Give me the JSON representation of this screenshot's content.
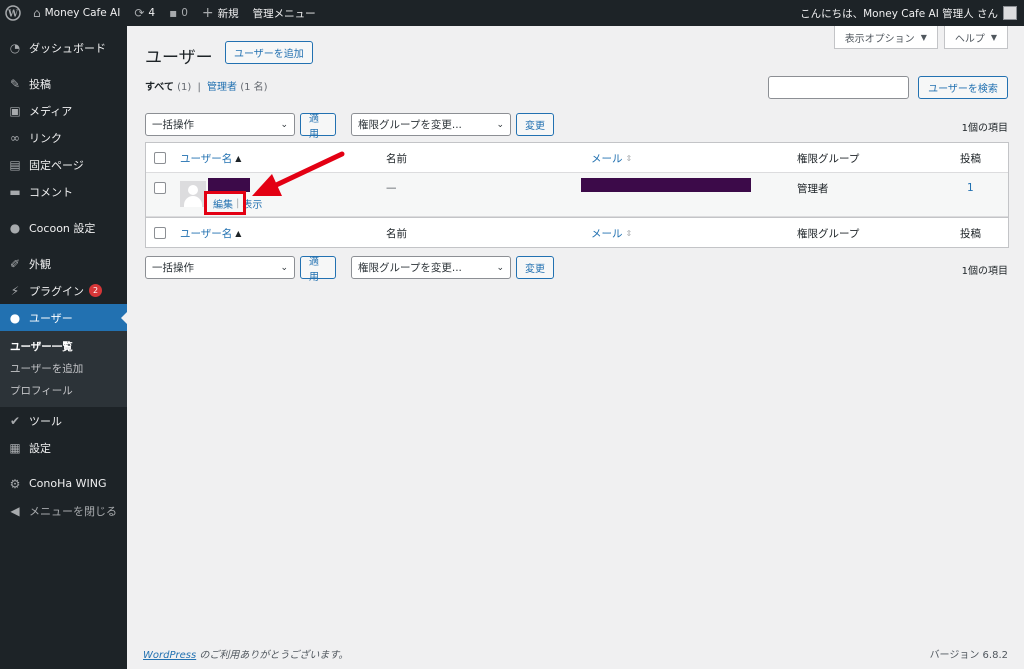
{
  "adminbar": {
    "site_name": "Money Cafe AI",
    "updates_count": "4",
    "comments_count": "0",
    "new_label": "新規",
    "admin_menu_label": "管理メニュー",
    "greeting": "こんにちは、Money Cafe AI 管理人 さん"
  },
  "sidebar": {
    "items": [
      {
        "label": "ダッシュボード",
        "icon": "dashboard-icon"
      },
      {
        "label": "投稿",
        "icon": "pin-icon"
      },
      {
        "label": "メディア",
        "icon": "media-icon"
      },
      {
        "label": "リンク",
        "icon": "link-icon"
      },
      {
        "label": "固定ページ",
        "icon": "page-icon"
      },
      {
        "label": "コメント",
        "icon": "comment-icon"
      },
      {
        "label": "Cocoon 設定",
        "icon": "cocoon-icon"
      },
      {
        "label": "外観",
        "icon": "appearance-icon"
      },
      {
        "label": "プラグイン",
        "icon": "plugin-icon",
        "badge": "2"
      },
      {
        "label": "ユーザー",
        "icon": "user-icon"
      },
      {
        "label": "ツール",
        "icon": "tools-icon"
      },
      {
        "label": "設定",
        "icon": "settings-icon"
      },
      {
        "label": "ConoHa WING",
        "icon": "gear-icon"
      },
      {
        "label": "メニューを閉じる",
        "icon": "collapse-icon"
      }
    ],
    "submenu": [
      "ユーザー一覧",
      "ユーザーを追加",
      "プロフィール"
    ]
  },
  "screen_options": {
    "label": "表示オプション",
    "help": "ヘルプ"
  },
  "page": {
    "title": "ユーザー",
    "add_button": "ユーザーを追加",
    "filter_all": "すべて",
    "filter_all_count": "(1)",
    "filter_sep": "|",
    "filter_admin": "管理者",
    "filter_admin_count": "(1 名)",
    "search_button": "ユーザーを検索",
    "search_value": ""
  },
  "actions": {
    "bulk_selected": "一括操作",
    "apply": "適用",
    "role_selected": "権限グループを変更...",
    "change": "変更",
    "items_count": "1個の項目"
  },
  "table": {
    "headers": [
      "ユーザー名",
      "名前",
      "メール",
      "権限グループ",
      "投稿"
    ],
    "rows": [
      {
        "username": "",
        "name": "—",
        "email": "",
        "role": "管理者",
        "posts": "1"
      }
    ],
    "row_actions": {
      "edit": "編集",
      "sep": "|",
      "view": "表示"
    }
  },
  "footer": {
    "wp_link": "WordPress",
    "thanks": " のご利用ありがとうございます。",
    "version": "バージョン 6.8.2"
  },
  "colors": {
    "accent": "#2271b1",
    "sidebar_bg": "#1d2327",
    "highlight_red": "#e30013",
    "redaction": "#3c0a49"
  }
}
